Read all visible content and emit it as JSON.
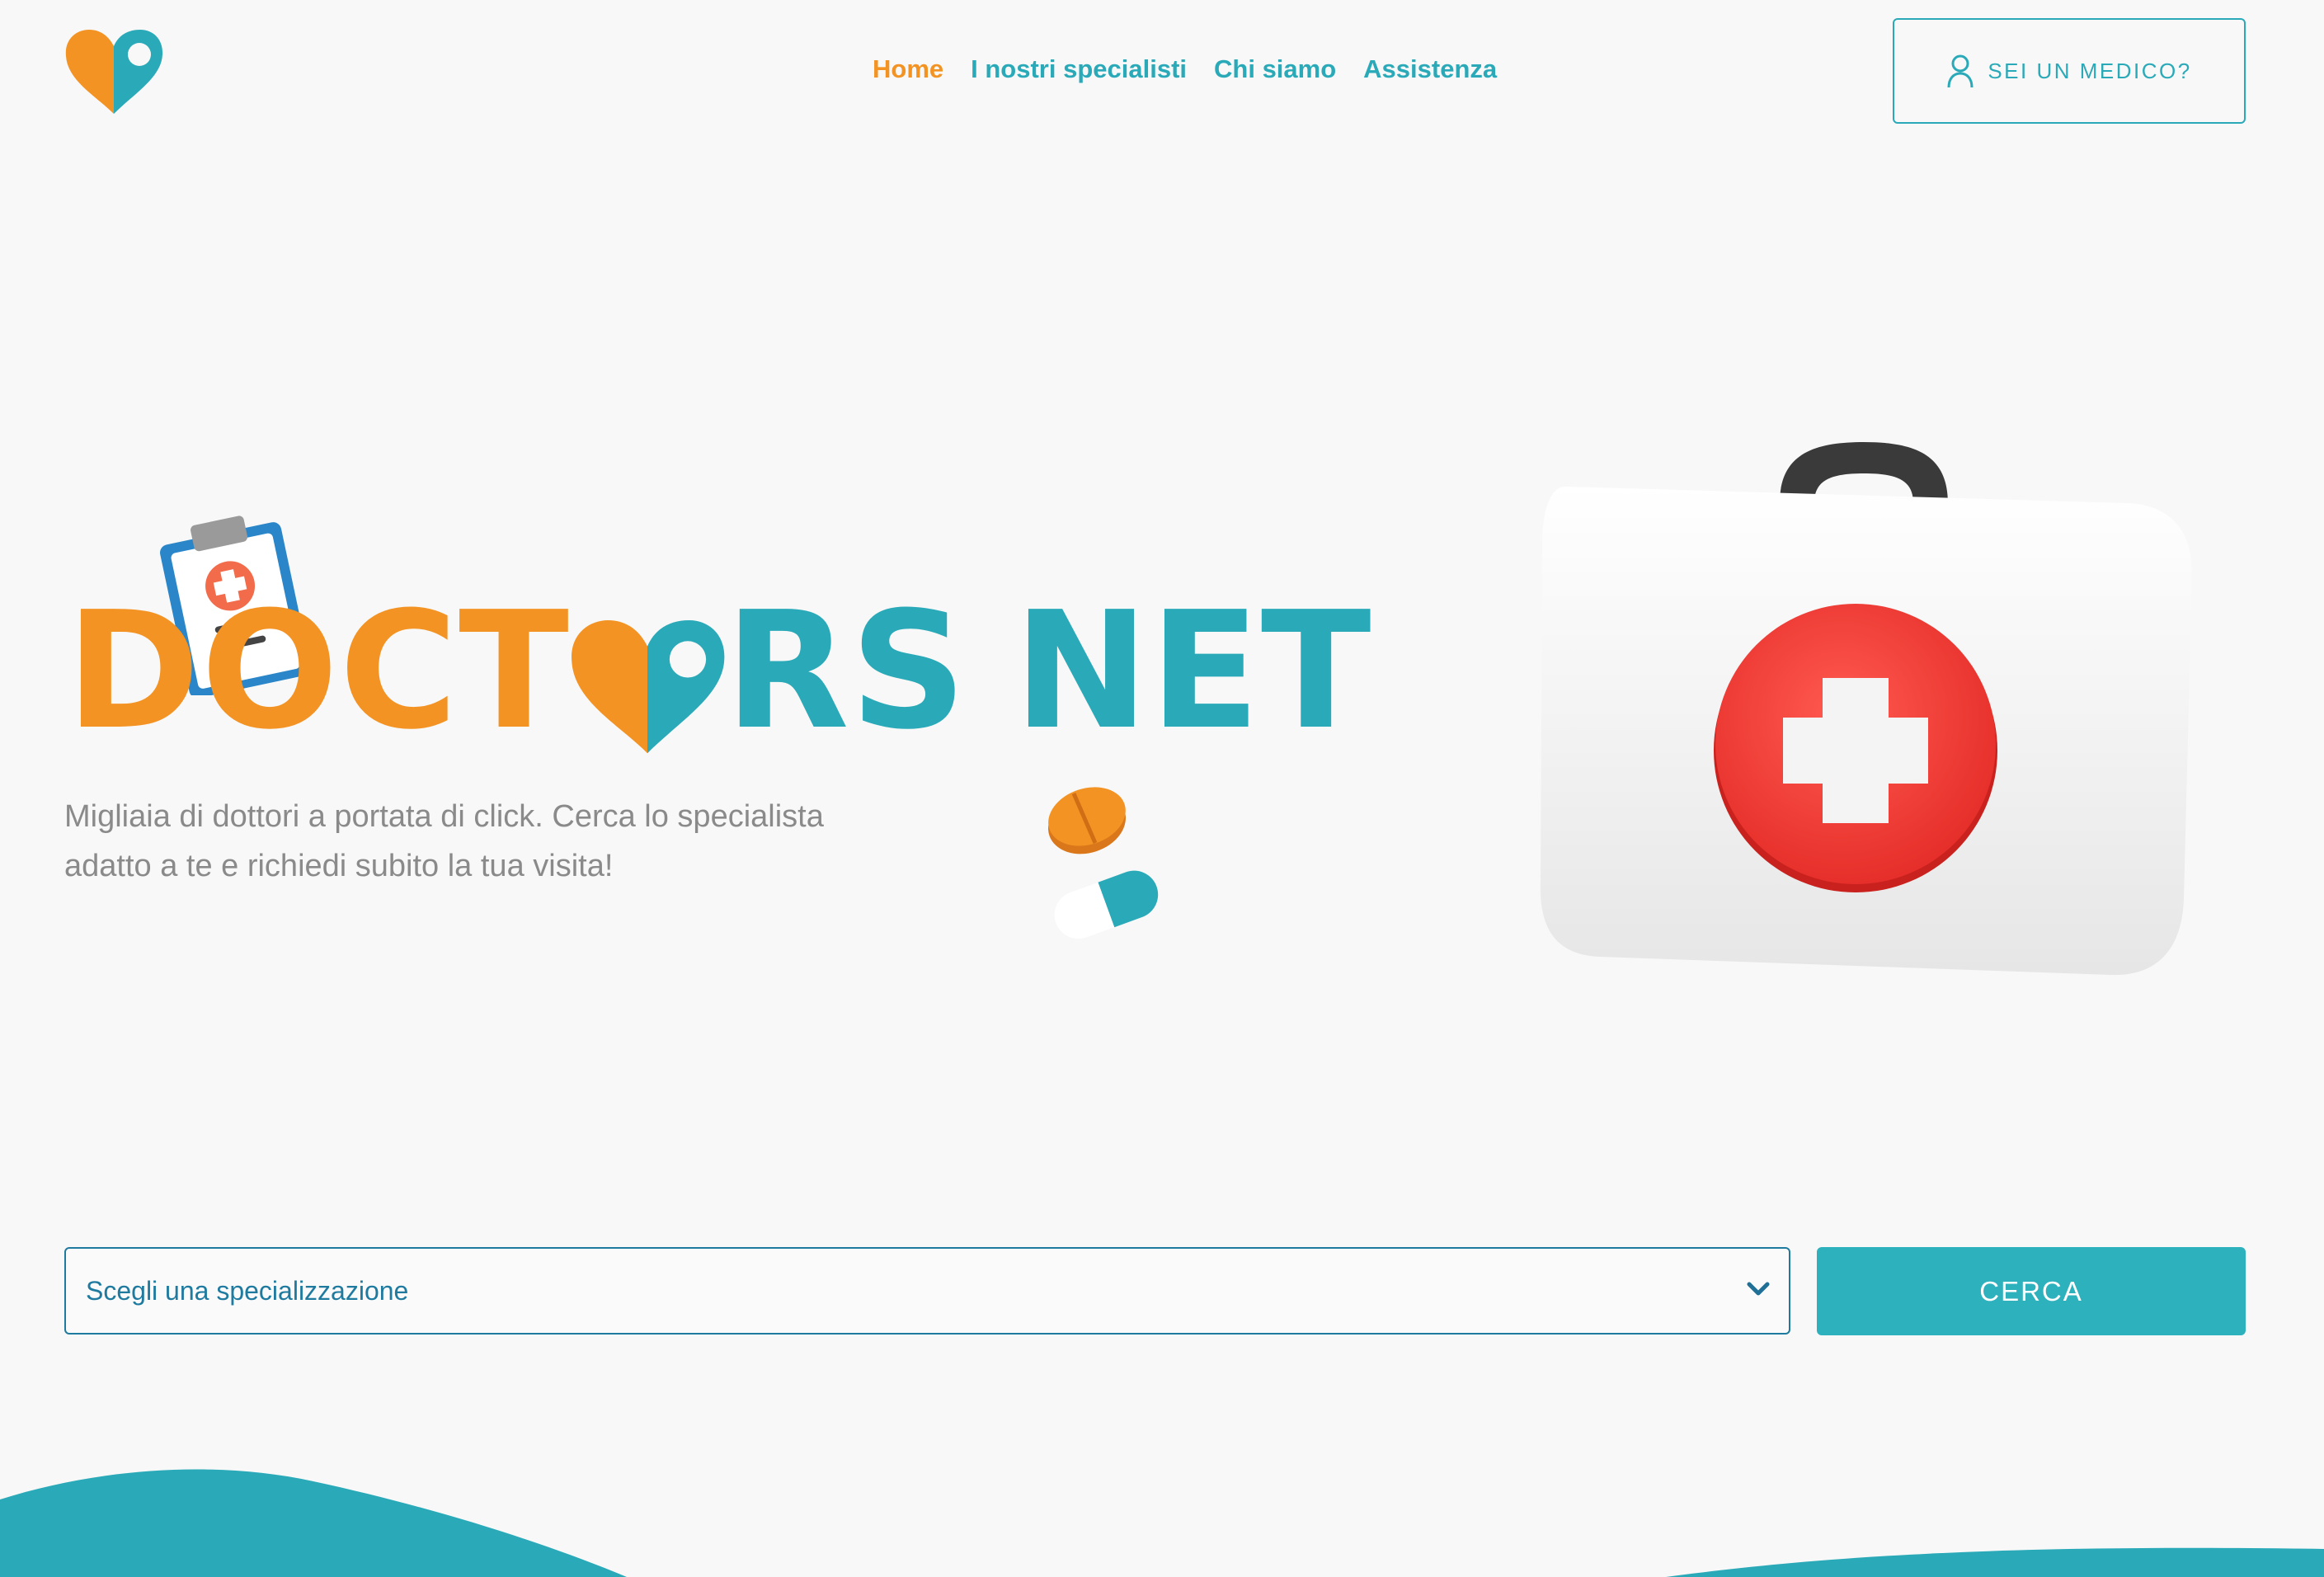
{
  "header": {
    "logo_icon": "heart-pin-icon",
    "nav": [
      {
        "label": "Home",
        "active": true
      },
      {
        "label": "I nostri specialisti",
        "active": false
      },
      {
        "label": "Chi siamo",
        "active": false
      },
      {
        "label": "Assistenza",
        "active": false
      }
    ],
    "doctor_button_label": "SEI UN MEDICO?",
    "doctor_button_icon": "user-icon"
  },
  "hero": {
    "brand_left": "DOCT",
    "brand_o_icon": "heart-pin-icon",
    "brand_right_a": "RS",
    "brand_right_b": "NET",
    "subtitle_line1": "Migliaia di dottori a portata di click. Cerca lo specialista",
    "subtitle_line2": "adatto a te e richiedi subito la tua visita!",
    "decorations": [
      "clipboard-icon",
      "pills-icon",
      "first-aid-kit-icon"
    ]
  },
  "search": {
    "select_text": "Scegli una specializzazione",
    "select_icon": "chevron-down-icon",
    "button_label": "CERCA"
  },
  "colors": {
    "orange": "#f39323",
    "teal": "#2aaab8",
    "button_teal": "#2db1bd",
    "select_border": "#1f7aa0",
    "subtitle_gray": "#8a8a8a",
    "background": "#f8f8f8"
  }
}
